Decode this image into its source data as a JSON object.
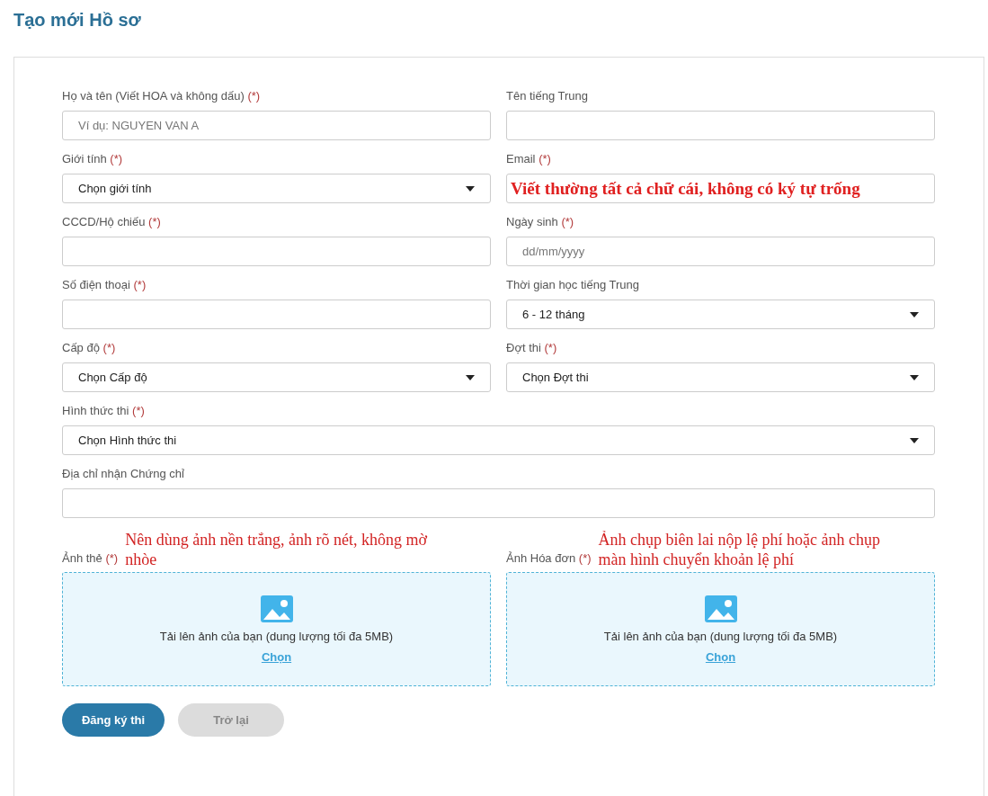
{
  "title": "Tạo mới Hồ sơ",
  "fields": [
    {
      "kind": "text",
      "label": "Họ và tên (Viết HOA và không dấu)",
      "required_mark": "(*)",
      "placeholder": "Ví dụ: NGUYEN VAN A",
      "wide": false
    },
    {
      "kind": "text",
      "label": "Tên tiếng Trung",
      "wide": false
    },
    {
      "kind": "select",
      "label": "Giới tính",
      "required_mark": "(*)",
      "value": "Chọn giới tính",
      "wide": false
    },
    {
      "kind": "text",
      "label": "Email",
      "required_mark": "(*)",
      "note": "Viết thường tất cả chữ cái, không có ký tự trống",
      "wide": false
    },
    {
      "kind": "text",
      "label": "CCCD/Hộ chiếu",
      "required_mark": "(*)",
      "wide": false
    },
    {
      "kind": "text",
      "label": "Ngày sinh",
      "required_mark": "(*)",
      "placeholder": "dd/mm/yyyy",
      "wide": false
    },
    {
      "kind": "text",
      "label": "Số điện thoại",
      "required_mark": "(*)",
      "wide": false
    },
    {
      "kind": "select",
      "label": "Thời gian học tiếng Trung",
      "value": "6 - 12 tháng",
      "wide": false
    },
    {
      "kind": "select",
      "label": "Cấp độ",
      "required_mark": "(*)",
      "value": "Chọn Cấp độ",
      "wide": false
    },
    {
      "kind": "select",
      "label": "Đợt thi",
      "required_mark": "(*)",
      "value": "Chọn Đợt thi",
      "wide": false
    },
    {
      "kind": "select",
      "label": "Hình thức thi",
      "required_mark": "(*)",
      "value": "Chọn Hình thức thi",
      "wide": true
    },
    {
      "kind": "text",
      "label": "Địa chỉ nhận Chứng chỉ",
      "wide": true
    }
  ],
  "uploads": [
    {
      "label": "Ảnh thẻ",
      "required_mark": "(*)",
      "note": "Nên dùng ảnh nền trắng, ảnh rõ nét, không mờ nhòe",
      "hint": "Tải lên ảnh của bạn (dung lượng tối đa 5MB)",
      "link": "Chọn"
    },
    {
      "label": "Ảnh Hóa đơn",
      "required_mark": "(*)",
      "note": "Ảnh chụp biên lai nộp lệ phí hoặc ảnh chụp màn hình chuyển khoản lệ phí",
      "hint": "Tải lên ảnh của bạn (dung lượng tối đa 5MB)",
      "link": "Chọn"
    }
  ],
  "buttons": [
    {
      "kind": "primary",
      "label": "Đăng ký thi"
    },
    {
      "kind": "secondary",
      "label": "Trở lại"
    }
  ]
}
